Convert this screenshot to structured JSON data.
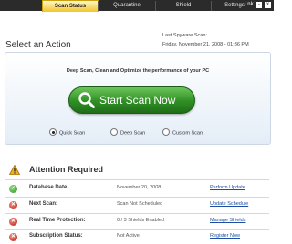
{
  "tabs": [
    {
      "label": "Scan Status",
      "active": true
    },
    {
      "label": "Quarantine",
      "active": false
    },
    {
      "label": "Shield",
      "active": false
    },
    {
      "label": "Settings",
      "active": false
    }
  ],
  "corner": {
    "label": "Lnk",
    "box1": "-",
    "box2": "x"
  },
  "select_action_title": "Select an Action",
  "last_scan": {
    "label": "Last Spyware Scan:",
    "value": "Friday, November 21, 2008 - 01:36 PM"
  },
  "action_panel": {
    "description": "Deep Scan, Clean and Optimize the performance of your PC",
    "start_button_label": "Start Scan Now",
    "scan_options": [
      {
        "label": "Quick Scan",
        "selected": true
      },
      {
        "label": "Deep Scan",
        "selected": false
      },
      {
        "label": "Custom Scan",
        "selected": false
      }
    ]
  },
  "attention_title": "Attention Required",
  "status_rows": [
    {
      "label": "Database Date:",
      "value": "November 20, 2008",
      "link": "Perform Update",
      "status": "ok"
    },
    {
      "label": "Next Scan:",
      "value": "Scan Not Scheduled",
      "link": "Update Schedule",
      "status": "error"
    },
    {
      "label": "Real Time Protection:",
      "value": "0 / 3 Shields Enabled",
      "link": "Manage Shields",
      "status": "error"
    },
    {
      "label": "Subscription Status:",
      "value": "Not Active",
      "link": "Register Now",
      "status": "error"
    }
  ],
  "colors": {
    "tab_active": "#f3c528",
    "tab_bar": "#2b2b2b",
    "scan_button": "#2f8f24",
    "link": "#1d4ea3",
    "ok_icon": "#2f8f24",
    "error_icon": "#b41d10"
  },
  "icons": {
    "start_button": "magnifier-icon",
    "attention": "warning-triangle-icon",
    "ok": "green-check-icon",
    "error": "red-x-icon"
  }
}
